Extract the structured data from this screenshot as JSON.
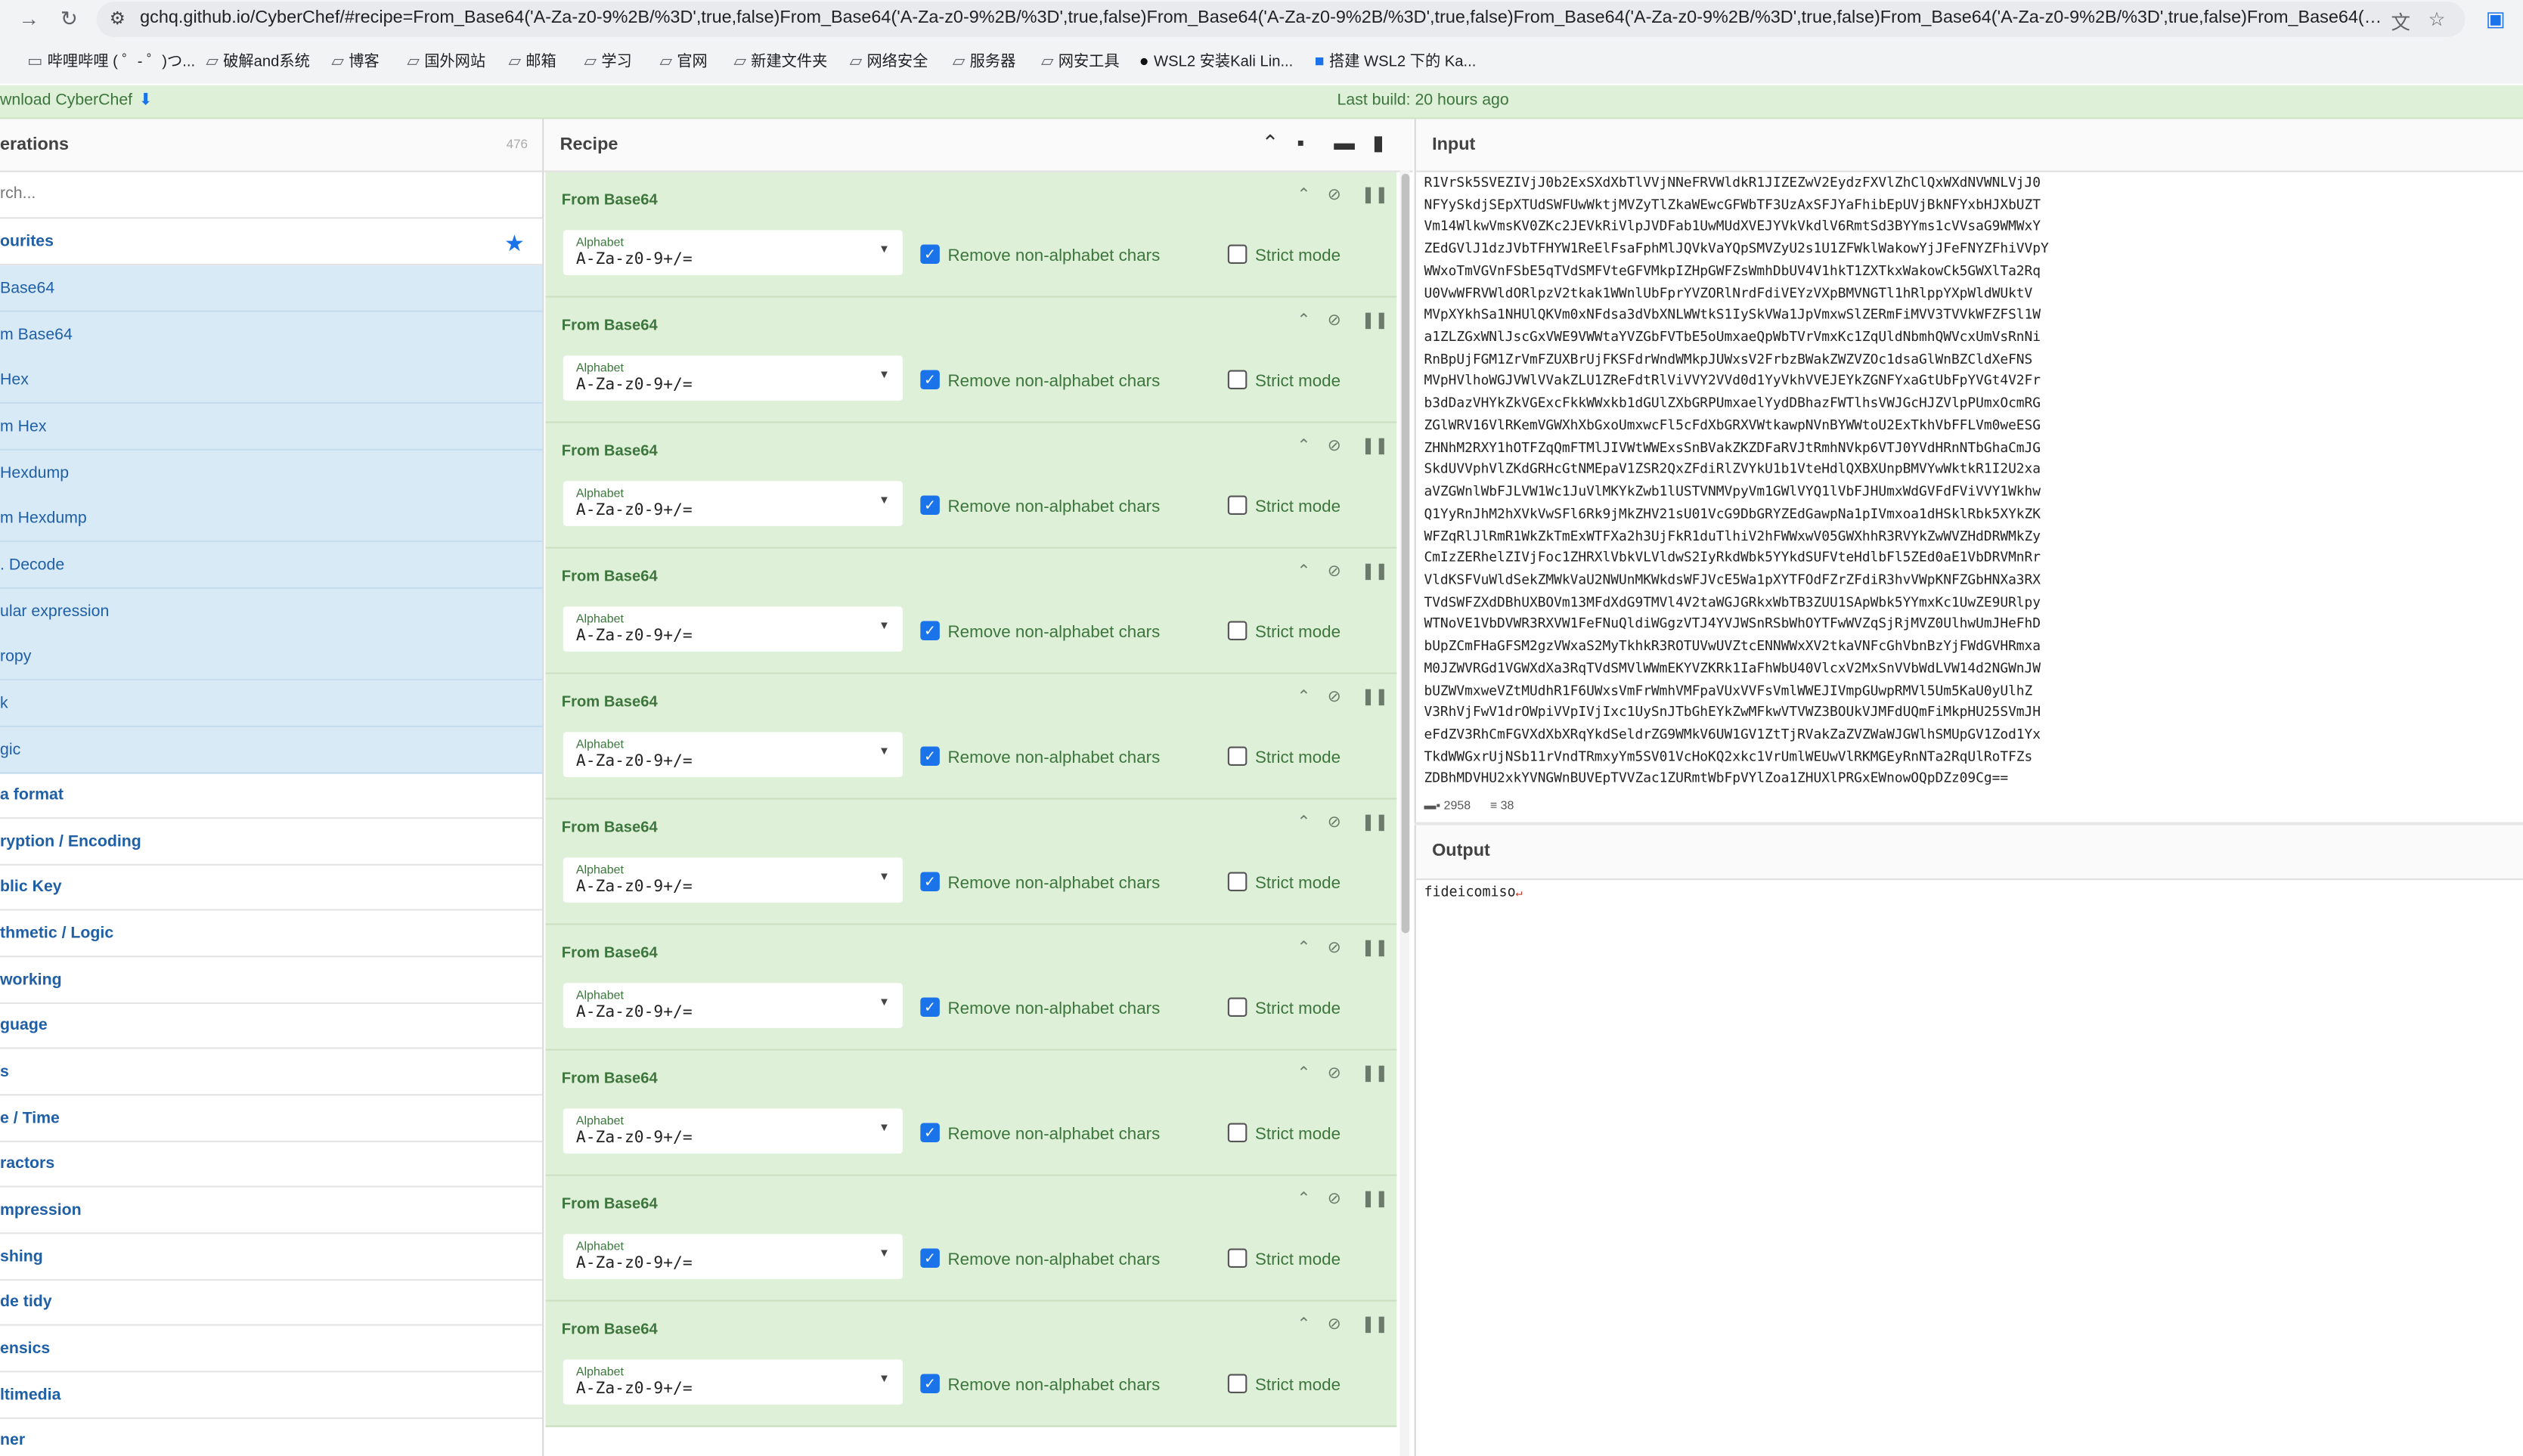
{
  "browser": {
    "url": "gchq.github.io/CyberChef/#recipe=From_Base64('A-Za-z0-9%2B/%3D',true,false)From_Base64('A-Za-z0-9%2B/%3D',true,false)From_Base64('A-Za-z0-9%2B/%3D',true,false)From_Base64('A-Za-z0-9%2B/%3D',true,false)From_Base64('A-Za-z0-9%2B/%3D',true,false)From_Base64('A-Za-z0-9%2B/...",
    "bookmarks": [
      "哔哩哔哩 ( ゜- ゜)つ...",
      "破解and系统",
      "博客",
      "国外网站",
      "邮箱",
      "学习",
      "官网",
      "新建文件夹",
      "网络安全",
      "服务器",
      "网安工具",
      "WSL2 安装Kali Lin...",
      "搭建 WSL2 下的 Ka..."
    ]
  },
  "banner": {
    "download": "wnload CyberChef",
    "build": "Last build: 20 hours ago"
  },
  "operations": {
    "title": "erations",
    "count": "476",
    "search_placeholder": "rch...",
    "favourites": "ourites",
    "fav_items": [
      "Base64",
      "m Base64",
      "Hex",
      "m Hex",
      "Hexdump",
      "m Hexdump",
      ". Decode",
      "ular expression",
      "ropy",
      "k",
      "gic"
    ],
    "categories": [
      "a format",
      "ryption / Encoding",
      "blic Key",
      "thmetic / Logic",
      "working",
      "guage",
      "s",
      "e / Time",
      "ractors",
      "mpression",
      "shing",
      "de tidy",
      "ensics",
      "ltimedia",
      "ner"
    ]
  },
  "recipe": {
    "title": "Recipe",
    "op_name": "From Base64",
    "alphabet_label": "Alphabet",
    "alphabet_value": "A-Za-z0-9+/=",
    "remove_label": "Remove non-alphabet chars",
    "strict_label": "Strict mode",
    "card_count": 10
  },
  "input": {
    "title": "Input",
    "lines": [
      "R1VrSk5SVEZIVjJ0b2ExSXdXbTlVVjNNeFRVWldkR1JIZEZwV2EydzFXVlZhClQxWXdNVWNLVjJ0",
      "NFYySkdjSEpXTUdSWFUwWktjMVZyTlZkaWEwcGFWbTF3UzAxSFJYaFhibEpUVjBkNFYxbHJXbUZT",
      "Vm14WlkwVmsKV0ZKc2JEVkRiVlpJVDFab1UwMUdXVEJYVkVkdlV6RmtSd3BYYms1cVVsaG9WMWxY",
      "ZEdGVlJ1dzJVbTFHYW1ReElFsaFphMlJQVkVaYQpSMVZyU2s1U1ZFWklWakowYjJFeFNYZFhiVVpY",
      "WWxoTmVGVnFSbE5qTVdSMFVteGFVMkpIZHpGWFZsWmhDbUV4V1hkT1ZXTkxWakowCk5GWXlTa2Rq",
      "U0VwWFRVWldORlpzV2tkak1WWnlUbFprYVZORlNrdFdiVEYzVXpBMVNGTl1hRlppYXpWldWUktV",
      "MVpXYkhSa1NHUlQKVm0xNFdsa3dVbXNLWWtkS1IySkVWa1JpVmxwSlZERmFiMVV3TVVkWFZFSl1W",
      "a1ZLZGxWNlJscGxVWE9VWWtaYVZGbFVTbE5oUmxaeQpWbTVrVmxKc1ZqUldNbmhQWVcxUmVsRnNi",
      "RnBpUjFGM1ZrVmFZUXBrUjFKSFdrWndWMkpJUWxsV2FrbzBWakZWZVZOc1dsaGlWnBZCldXeFNS",
      "MVpHVlhoWGJVWlVVakZLU1ZReFdtRlViVVY2VVd0d1YyVkhVVEJEYkZGNFYxaGtUbFpYVGt4V2Fr",
      "b3dDazVHYkZkVGExcFkkWWxkb1dGUlZXbGRPUmxaelYydDBhazFWTlhsVWJGcHJZVlpPUmxOcmRG",
      "ZGlWRV16VlRKemVGWXhXbGxoUmxwcFl5cFdXbGRXVWtkawpNVnBYWWtoU2ExTkhVbFFLVm0weESG",
      "ZHNhM2RXY1hOTFZqQmFTMlJIVWtWWExsSnBVakZKZDFaRVJtRmhNVkp6VTJ0YVdHRnNTbGhaCmJG",
      "SkdUVVphVlZKdGRHcGtNMEpaV1ZSR2QxZFdiRlZVYkU1b1VteHdlQXBXUnpBMVYwWktkR1I2U2xa",
      "aVZGWnlWbFJLVW1Wc1JuVlMKYkZwb1lUSTVNMVpyVm1GWlVYQ1lVbFJHUmxWdGVFdFViVVY1Wkhw",
      "Q1YyRnJhM2hXVkVwSFl6Rk9jMkZHV21sU01VcG9DbGRYZEdGawpNa1pIVmxoa1dHSklRbk5XYkZK",
      "WFZqRlJlRmR1WkZkTmExWTFXa2h3UjFkR1duTlhiV2hFWWxwV05GWXhhR3RVYkZwWVZHdDRWMkZy",
      "CmIzZERhelZIVjFoc1ZHRXlVbkVLVldwS2IyRkdWbk5YYkdSUFVteHdlbFl5ZEd0aE1VbDRVMnRr",
      "VldKSFVuWldSekZMWkVaU2NWUnMKWkdsWFJVcE5Wa1pXYTFOdFZrZFdiR3hvVWpKNFZGbHNXa3RX",
      "TVdSWFZXdDBhUXBOVm13MFdXdG9TMVl4V2taWGJGRkxWbTB3ZUU1SApWbk5YYmxKc1UwZE9URlpy",
      "WTNoVE1VbDVWR3RXVW1FeFNuQldiWGgzVTJ4YVJWSnRSbWhOYTFwWVZqSjRjMVZ0UlhwUmJHeFhD",
      "bUpZCmFHaGFSM2gzVWxaS2MyTkhkR3ROTUVwUVZtcENNWWxXV2tkaVNFcGhVbnBzYjFWdGVHRmxa",
      "M0JZWVRGd1VGWXdXa3RqTVdSMVlWWmEKYVZKRk1IaFhWbU40VlcxV2MxSnVVbWdLVW14d2NGWnJW",
      "bUZWVmxweVZtMUdhR1F6UWxsVmFrWmhVMFpaVUxVVFsVmlWWEJIVmpGUwpRMVl5Um5KaU0yUlhZ",
      "V3RhVjFwV1drOWpiVVpIVjIxc1UySnJTbGhEYkZwMFkwVTVWZ3BOUkVJMFdUQmFiMkpHU25SVmJH",
      "eFdZV3RhCmFGVXdXbXRqYkdSeldrZG9WMkV6UW1GV1ZtTjRVakZaZVZWaWJGWlhSMUpGV1Zod1Yx",
      "TkdWWGxrUjNSb11rVndTRmxyYm5SV01VcHoKQ2xkc1VrUmlWEUwVlRKMGEyRnNTa2RqUlRoTFZs",
      "ZDBhMDVHU2xkYVNGWnBUVEpTVVZac1ZURmtWbFpVYlZoa1ZHUXlPRGxEWnowOQpDZz09Cg=="
    ],
    "chars": "2958",
    "lines_count": "38"
  },
  "output": {
    "title": "Output",
    "text": "fideicomiso",
    "trailing": "↵"
  }
}
